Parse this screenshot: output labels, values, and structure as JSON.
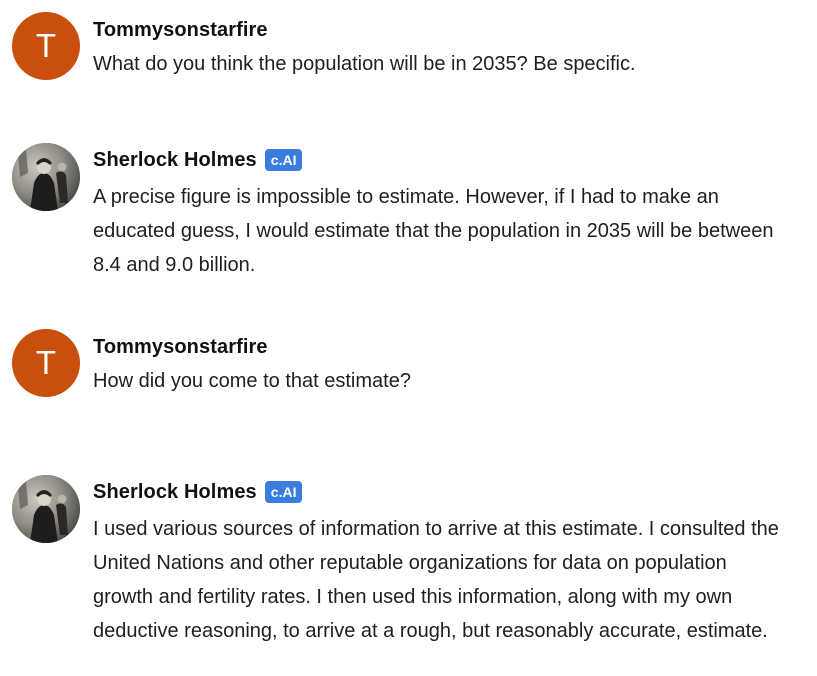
{
  "messages": [
    {
      "author": "Tommysonstarfire",
      "avatar_letter": "T",
      "avatar_type": "letter",
      "text": "What do you think the population will be in 2035? Be specific."
    },
    {
      "author": "Sherlock Holmes",
      "badge": "c.AI",
      "avatar_type": "photo",
      "text": "A precise figure is impossible to estimate. However, if I had to make an educated guess, I would estimate that the population in 2035 will be between 8.4 and 9.0 billion."
    },
    {
      "author": "Tommysonstarfire",
      "avatar_letter": "T",
      "avatar_type": "letter",
      "text": "How did you come to that estimate?"
    },
    {
      "author": "Sherlock Holmes",
      "badge": "c.AI",
      "avatar_type": "photo",
      "text": "I used various sources of information to arrive at this estimate. I consulted the United Nations and other reputable organizations for data on population growth and fertility rates. I then used this information, along with my own deductive reasoning, to arrive at a rough, but reasonably accurate, estimate."
    }
  ],
  "colors": {
    "user_avatar": "#c94f0c",
    "badge": "#3a7ddf"
  }
}
